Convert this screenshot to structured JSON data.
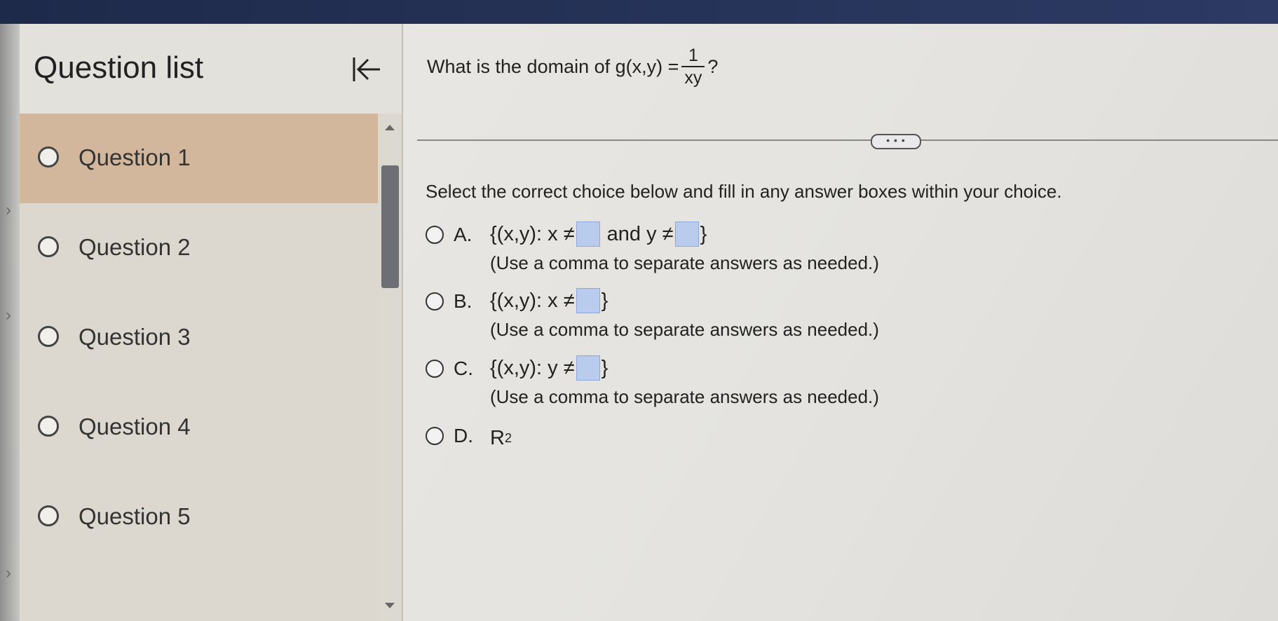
{
  "sidebar": {
    "title": "Question list",
    "questions": [
      {
        "label": "Question 1"
      },
      {
        "label": "Question 2"
      },
      {
        "label": "Question 3"
      },
      {
        "label": "Question 4"
      },
      {
        "label": "Question 5"
      }
    ],
    "active_index": 0
  },
  "question": {
    "prefix": "What is the domain of g(x,y) =",
    "numerator": "1",
    "denominator": "xy",
    "suffix": "?"
  },
  "more_button_label": "• • •",
  "instruction": "Select the correct choice below and fill in any answer boxes within your choice.",
  "choices": [
    {
      "letter": "A.",
      "expr_a": "{(x,y): x ≠",
      "expr_b": "and y ≠",
      "close": "}",
      "hint": "(Use a comma to separate answers as needed.)"
    },
    {
      "letter": "B.",
      "expr_a": "{(x,y): x ≠",
      "close": "}",
      "hint": "(Use a comma to separate answers as needed.)"
    },
    {
      "letter": "C.",
      "expr_a": "{(x,y): y ≠",
      "close": "}",
      "hint": "(Use a comma to separate answers as needed.)"
    },
    {
      "letter": "D.",
      "base": "R",
      "sup": "2"
    }
  ],
  "colors": {
    "active_item": "#d3b79d",
    "answer_box": "#b9ccee",
    "scroll_thumb": "#6d6f74"
  }
}
